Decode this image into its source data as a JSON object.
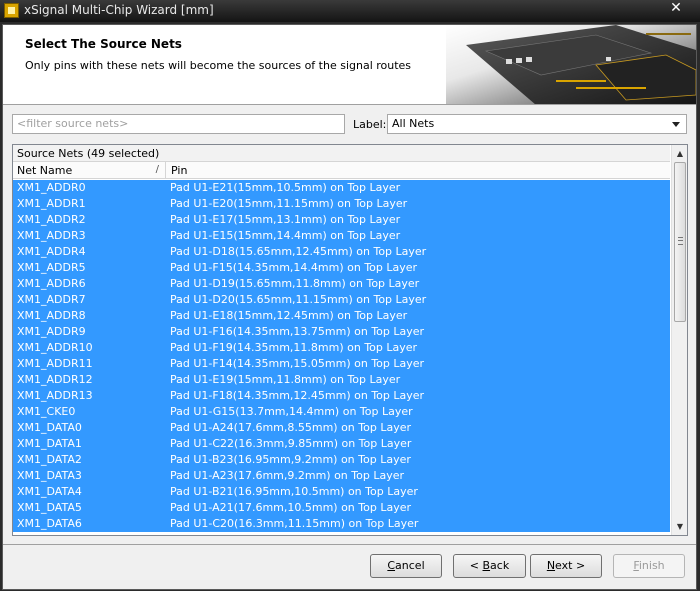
{
  "window": {
    "title": "xSignal Multi-Chip Wizard [mm]",
    "close_glyph": "✕"
  },
  "header": {
    "title": "Select The Source Nets",
    "subtitle": "Only pins with these nets will become the sources of the signal routes"
  },
  "filter": {
    "placeholder": "<filter source nets>"
  },
  "label_select": {
    "label": "Label:",
    "value": "All Nets"
  },
  "grid": {
    "group_header": "Source Nets (49 selected)",
    "columns": [
      "Net Name",
      "Pin"
    ],
    "sort_glyph": "/",
    "rows": [
      {
        "net": "XM1_ADDR0",
        "pin": "Pad U1-E21(15mm,10.5mm) on Top Layer"
      },
      {
        "net": "XM1_ADDR1",
        "pin": "Pad U1-E20(15mm,11.15mm) on Top Layer"
      },
      {
        "net": "XM1_ADDR2",
        "pin": "Pad U1-E17(15mm,13.1mm) on Top Layer"
      },
      {
        "net": "XM1_ADDR3",
        "pin": "Pad U1-E15(15mm,14.4mm) on Top Layer"
      },
      {
        "net": "XM1_ADDR4",
        "pin": "Pad U1-D18(15.65mm,12.45mm) on Top Layer"
      },
      {
        "net": "XM1_ADDR5",
        "pin": "Pad U1-F15(14.35mm,14.4mm) on Top Layer"
      },
      {
        "net": "XM1_ADDR6",
        "pin": "Pad U1-D19(15.65mm,11.8mm) on Top Layer"
      },
      {
        "net": "XM1_ADDR7",
        "pin": "Pad U1-D20(15.65mm,11.15mm) on Top Layer"
      },
      {
        "net": "XM1_ADDR8",
        "pin": "Pad U1-E18(15mm,12.45mm) on Top Layer"
      },
      {
        "net": "XM1_ADDR9",
        "pin": "Pad U1-F16(14.35mm,13.75mm) on Top Layer"
      },
      {
        "net": "XM1_ADDR10",
        "pin": "Pad U1-F19(14.35mm,11.8mm) on Top Layer"
      },
      {
        "net": "XM1_ADDR11",
        "pin": "Pad U1-F14(14.35mm,15.05mm) on Top Layer"
      },
      {
        "net": "XM1_ADDR12",
        "pin": "Pad U1-E19(15mm,11.8mm) on Top Layer"
      },
      {
        "net": "XM1_ADDR13",
        "pin": "Pad U1-F18(14.35mm,12.45mm) on Top Layer"
      },
      {
        "net": "XM1_CKE0",
        "pin": "Pad U1-G15(13.7mm,14.4mm) on Top Layer"
      },
      {
        "net": "XM1_DATA0",
        "pin": "Pad U1-A24(17.6mm,8.55mm) on Top Layer"
      },
      {
        "net": "XM1_DATA1",
        "pin": "Pad U1-C22(16.3mm,9.85mm) on Top Layer"
      },
      {
        "net": "XM1_DATA2",
        "pin": "Pad U1-B23(16.95mm,9.2mm) on Top Layer"
      },
      {
        "net": "XM1_DATA3",
        "pin": "Pad U1-A23(17.6mm,9.2mm) on Top Layer"
      },
      {
        "net": "XM1_DATA4",
        "pin": "Pad U1-B21(16.95mm,10.5mm) on Top Layer"
      },
      {
        "net": "XM1_DATA5",
        "pin": "Pad U1-A21(17.6mm,10.5mm) on Top Layer"
      },
      {
        "net": "XM1_DATA6",
        "pin": "Pad U1-C20(16.3mm,11.15mm) on Top Layer"
      }
    ]
  },
  "buttons": {
    "cancel": {
      "pre": "",
      "u": "C",
      "post": "ancel"
    },
    "back": {
      "pre": "< ",
      "u": "B",
      "post": "ack"
    },
    "next": {
      "pre": "",
      "u": "N",
      "post": "ext >"
    },
    "finish": {
      "pre": "",
      "u": "F",
      "post": "inish"
    }
  },
  "colors": {
    "selection": "#3399ff",
    "accent_gold": "#d9a400"
  }
}
